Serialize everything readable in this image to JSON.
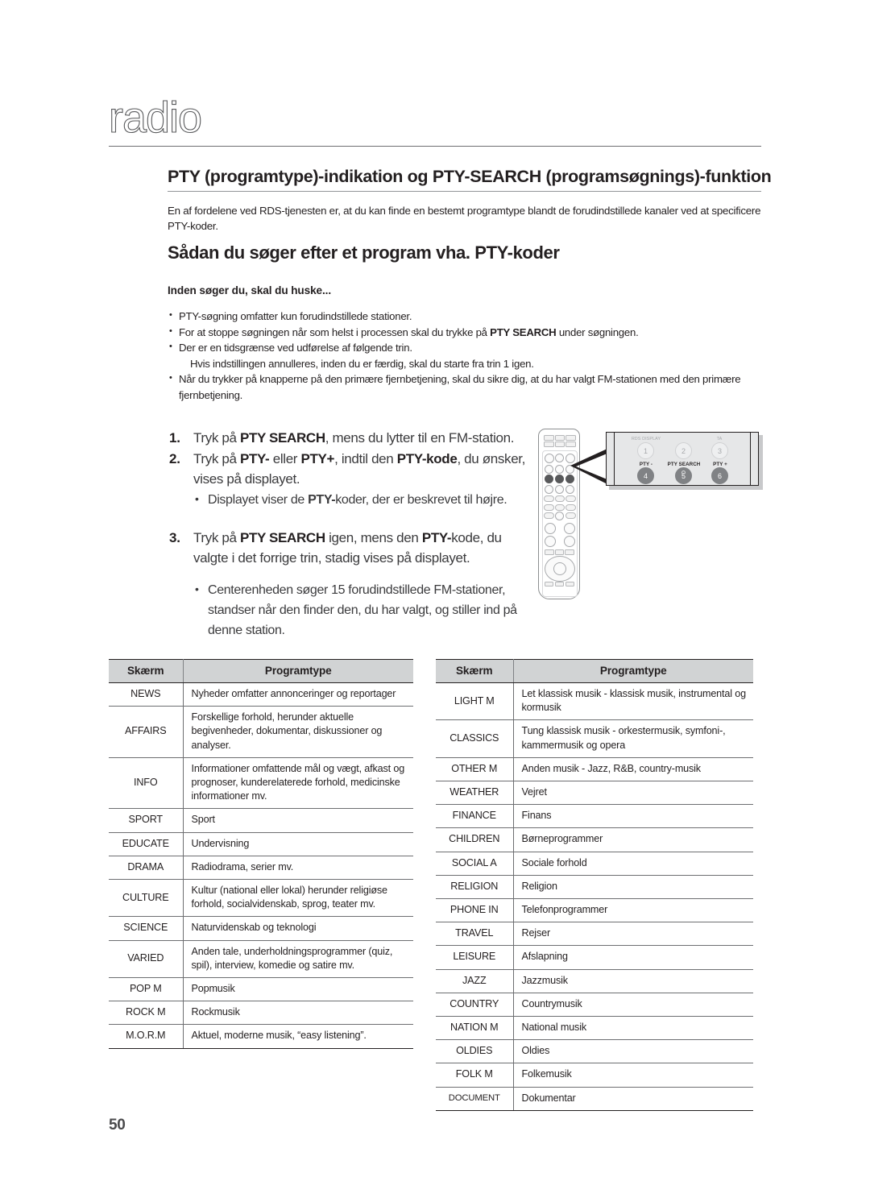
{
  "masthead": {
    "word": "radio"
  },
  "section": {
    "title": "PTY (programtype)-indikation og PTY-SEARCH (programsøgnings)-funktion",
    "intro": "En af fordelene ved RDS-tjenesten er, at du kan finde en bestemt programtype blandt de forudindstillede kanaler ved at specificere PTY-koder."
  },
  "subsection": {
    "title": "Sådan du søger efter et program vha. PTY-koder",
    "remember_heading": "Inden søger du, skal du huske...",
    "bullets": [
      {
        "text": "PTY-søgning omfatter kun forudindstillede stationer."
      },
      {
        "text": "For at stoppe søgningen når som helst i processen skal du trykke på PTY SEARCH under søgningen.",
        "bold": "PTY SEARCH"
      },
      {
        "text": "Der er en tidsgrænse ved udførelse af følgende trin.",
        "continuation": "Hvis indstillingen annulleres, inden du er færdig, skal du starte fra trin 1 igen."
      },
      {
        "text": "Når du trykker på knapperne på den primære fjernbetjening, skal du sikre dig, at du har valgt FM-stationen med den primære fjernbetjening."
      }
    ]
  },
  "steps": [
    {
      "num": "1.",
      "text": "Tryk på PTY SEARCH, mens du lytter til en FM-station."
    },
    {
      "num": "2.",
      "text": "Tryk på PTY- eller PTY+, indtil den PTY-kode, du ønsker, vises på displayet.",
      "sub": "Displayet viser de PTY-koder, der er beskrevet til højre."
    },
    {
      "num": "3.",
      "text": "Tryk på PTY SEARCH igen, mens den PTY-kode, du valgte i det forrige trin, stadig vises på displayet.",
      "sub": "Centerenheden søger 15 forudindstillede FM-stationer, standser når den finder den, du har valgt, og stiller ind på denne station."
    }
  ],
  "callout": {
    "top_labels": [
      "RDS DISPLAY",
      "TA"
    ],
    "top_buttons": [
      "1",
      "2",
      "3"
    ],
    "bottom_labels": [
      "PTY -",
      "PTY SEARCH",
      "PTY +"
    ],
    "bottom_buttons": [
      "4",
      "5",
      "6"
    ]
  },
  "tables": {
    "headers": [
      "Skærm",
      "Programtype"
    ],
    "left_rows": [
      {
        "code": "NEWS",
        "desc": "Nyheder omfatter annonceringer og reportager"
      },
      {
        "code": "AFFAIRS",
        "desc": "Forskellige forhold, herunder aktuelle begivenheder, dokumentar, diskussioner og analyser."
      },
      {
        "code": "INFO",
        "desc": "Informationer omfattende mål og vægt, afkast og prognoser, kunderelaterede forhold, medicinske informationer mv."
      },
      {
        "code": "SPORT",
        "desc": "Sport"
      },
      {
        "code": "EDUCATE",
        "desc": "Undervisning"
      },
      {
        "code": "DRAMA",
        "desc": "Radiodrama, serier mv."
      },
      {
        "code": "CULTURE",
        "desc": "Kultur (national eller lokal) herunder religiøse forhold, socialvidenskab, sprog, teater mv."
      },
      {
        "code": "SCIENCE",
        "desc": "Naturvidenskab og teknologi"
      },
      {
        "code": "VARIED",
        "desc": "Anden tale, underholdningsprogrammer (quiz, spil), interview, komedie og satire mv."
      },
      {
        "code": "POP M",
        "desc": "Popmusik"
      },
      {
        "code": "ROCK M",
        "desc": "Rockmusik"
      },
      {
        "code": "M.O.R.M",
        "desc": "Aktuel, moderne musik, “easy listening”."
      }
    ],
    "right_rows": [
      {
        "code": "LIGHT M",
        "desc": "Let klassisk musik - klassisk musik, instrumental og kormusik"
      },
      {
        "code": "CLASSICS",
        "desc": "Tung klassisk musik - orkestermusik, symfoni-, kammermusik og opera"
      },
      {
        "code": "OTHER M",
        "desc": "Anden musik - Jazz, R&B, country-musik"
      },
      {
        "code": "WEATHER",
        "desc": "Vejret"
      },
      {
        "code": "FINANCE",
        "desc": "Finans"
      },
      {
        "code": "CHILDREN",
        "desc": "Børneprogrammer"
      },
      {
        "code": "SOCIAL A",
        "desc": "Sociale forhold"
      },
      {
        "code": "RELIGION",
        "desc": "Religion"
      },
      {
        "code": "PHONE IN",
        "desc": "Telefonprogrammer"
      },
      {
        "code": "TRAVEL",
        "desc": "Rejser"
      },
      {
        "code": "LEISURE",
        "desc": "Afslapning"
      },
      {
        "code": "JAZZ",
        "desc": "Jazzmusik"
      },
      {
        "code": "COUNTRY",
        "desc": "Countrymusik"
      },
      {
        "code": "NATION M",
        "desc": "National musik"
      },
      {
        "code": "OLDIES",
        "desc": "Oldies"
      },
      {
        "code": "FOLK M",
        "desc": "Folkemusik"
      },
      {
        "code": "DOCUMENT",
        "desc": "Dokumentar",
        "small": true
      }
    ]
  },
  "footer": {
    "page_number": "50"
  }
}
